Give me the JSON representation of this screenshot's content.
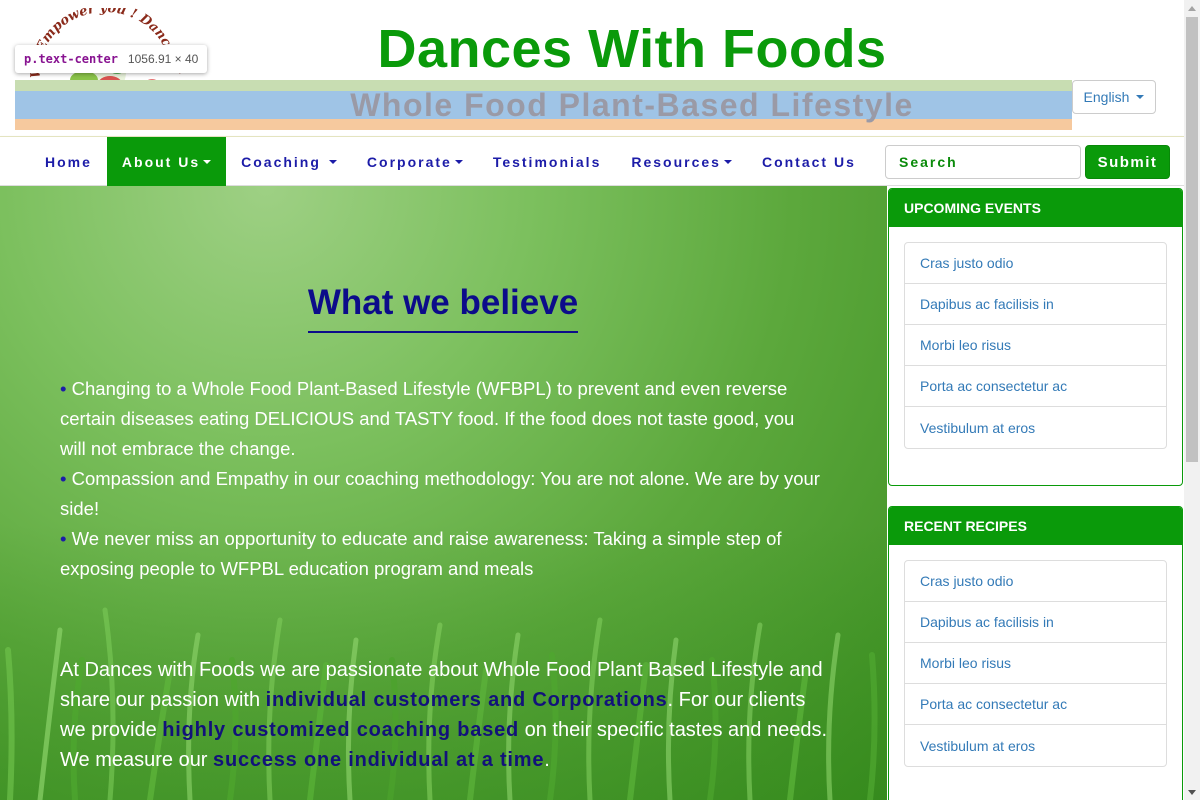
{
  "header": {
    "site_title": "Dances With Foods",
    "subtitle": "Whole Food Plant-Based Lifestyle",
    "logo_text": "We Empower you ! Dance With Foods",
    "language_button": "English"
  },
  "devtools_tooltip": {
    "selector": "p.text-center",
    "dimensions": "1056.91 × 40"
  },
  "nav": {
    "items": [
      {
        "label": "Home",
        "has_dropdown": false,
        "active": false
      },
      {
        "label": "About Us",
        "has_dropdown": true,
        "active": true
      },
      {
        "label": "Coaching",
        "has_dropdown": true,
        "active": false
      },
      {
        "label": "Corporate",
        "has_dropdown": true,
        "active": false
      },
      {
        "label": "Testimonials",
        "has_dropdown": false,
        "active": false
      },
      {
        "label": "Resources",
        "has_dropdown": true,
        "active": false
      },
      {
        "label": "Contact Us",
        "has_dropdown": false,
        "active": false
      }
    ],
    "search_placeholder": "Search",
    "submit_label": "Submit"
  },
  "main": {
    "heading": "What we believe",
    "bullet_glyph": "•",
    "beliefs": [
      "Changing to a Whole Food Plant-Based Lifestyle (WFBPL) to prevent and even reverse certain diseases eating DELICIOUS and TASTY food. If the food does not taste good, you will not embrace the change.",
      "Compassion and Empathy in our coaching methodology: You are not alone. We are by your side!",
      "We never miss an opportunity to educate and raise awareness: Taking a simple step of exposing people to WFPBL education program and meals"
    ],
    "about": {
      "part1": "At Dances with Foods we are passionate about Whole Food Plant Based Lifestyle and share our passion with ",
      "hl1": "individual customers and Corporations",
      "part2": ". For our clients we provide ",
      "hl2": "highly customized coaching based",
      "part3": " on their specific tastes and needs. We measure our ",
      "hl3": "success one individual at a time",
      "part4": "."
    }
  },
  "sidebar": {
    "upcoming_events": {
      "title": "UPCOMING EVENTS",
      "items": [
        "Cras justo odio",
        "Dapibus ac facilisis in",
        "Morbi leo risus",
        "Porta ac consectetur ac",
        "Vestibulum at eros"
      ]
    },
    "recent_recipes": {
      "title": "RECENT RECIPES",
      "items": [
        "Cras justo odio",
        "Dapibus ac facilisis in",
        "Morbi leo risus",
        "Porta ac consectetur ac",
        "Vestibulum at eros"
      ]
    }
  },
  "colors": {
    "brand_green": "#0a9a0a",
    "nav_text": "#1c1ca8",
    "heading_navy": "#0c0c8a",
    "link_blue": "#337ab7",
    "subtitle_gray": "#9a9aa6"
  }
}
